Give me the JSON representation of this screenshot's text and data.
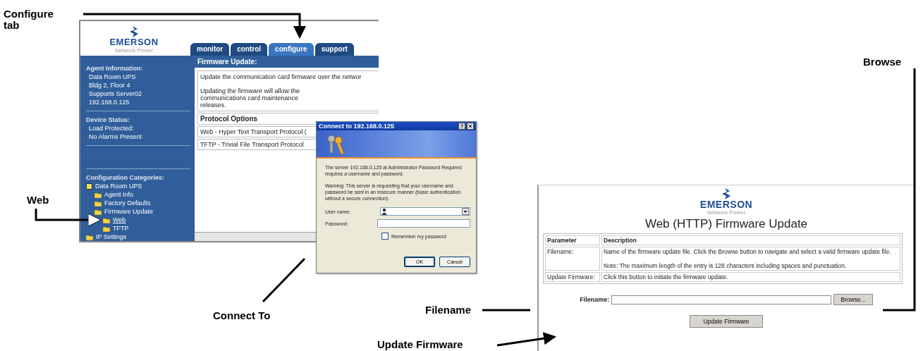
{
  "callouts": [
    {
      "text": "Configure tab"
    },
    {
      "text": "Web"
    },
    {
      "text": "Connect To"
    },
    {
      "text": "Filename"
    },
    {
      "text": "Browse"
    },
    {
      "text": "Update Firmware"
    }
  ],
  "web_console": {
    "logo": {
      "brand": "EMERSON",
      "tagline": "Network Power"
    },
    "tabs": [
      {
        "label": "monitor",
        "selected": false
      },
      {
        "label": "control",
        "selected": false
      },
      {
        "label": "configure",
        "selected": true
      },
      {
        "label": "support",
        "selected": false
      }
    ],
    "sidebar": {
      "sections": [
        {
          "heading": "Agent Information:",
          "lines": [
            "Data Room UPS",
            "Bldg 2, Floor 4",
            "Supports Server02",
            "192.168.0.125"
          ]
        },
        {
          "heading": "Device Status:",
          "lines": [
            "Load Protected:",
            "No Alarms Present"
          ]
        }
      ],
      "categories": {
        "heading": "Configuration Categories:",
        "tree": [
          {
            "label": "Data Room UPS",
            "selected": false,
            "children": [
              {
                "label": "Agent Info",
                "selected": false
              },
              {
                "label": "Factory Defaults",
                "selected": false
              },
              {
                "label": "Firmware Update",
                "selected": false,
                "children": [
                  {
                    "label": "Web",
                    "selected": true
                  },
                  {
                    "label": "TFTP",
                    "selected": false
                  }
                ]
              }
            ]
          },
          {
            "label": "IP Settings",
            "selected": false
          }
        ]
      }
    },
    "content": {
      "heading": "Firmware Update:",
      "paragraphs": [
        "Update the communication card firmware over the networ",
        "Updating the firmware will allow the communications card maintenance releases."
      ],
      "table": {
        "header": "Protocol Options",
        "rows": [
          "Web - Hyper Text Transport Protocol (",
          "TFTP - Trivial File Transport Protocol"
        ]
      }
    }
  },
  "login_dialog": {
    "title": "Connect to 192.168.0.125",
    "message": "The server 192.168.0.125 at Administrator Password Required requires a username and password.",
    "warning": "Warning: This server is requesting that your username and password be sent in an insecure manner (basic authentication without a secure connection).",
    "user_name_label": "User name:",
    "password_label": "Password:",
    "remember": {
      "label": "Remember my password",
      "checked": false
    },
    "buttons": [
      "OK",
      "Cancel"
    ]
  },
  "firmware_page": {
    "logo": {
      "brand": "EMERSON",
      "tagline": "Network Power"
    },
    "title": "Web (HTTP) Firmware Update",
    "table": {
      "columns": [
        "Parameter",
        "Description"
      ],
      "rows": [
        {
          "parameter": "Filename:",
          "description": [
            "Name of the firmware update file. Click the Browse button to navigate and select a valid firmware update file.",
            "Note: The maximum length of the entry is 128 characters including spaces and punctuation."
          ]
        },
        {
          "parameter": "Update Firmware:",
          "description": [
            "Click this button to initiate the firmware update."
          ]
        }
      ]
    },
    "filename_label": "Filename:",
    "browse_button": "Browse...",
    "update_button": "Update Firmware"
  }
}
